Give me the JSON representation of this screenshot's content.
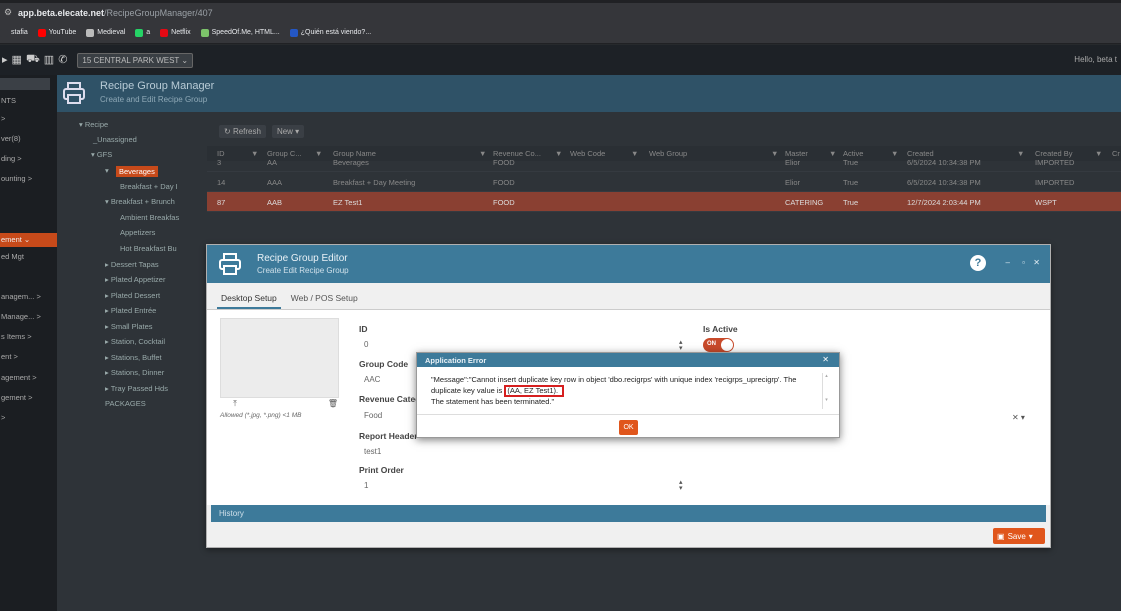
{
  "browser": {
    "url_host": "app.beta.elecate.net",
    "url_path": "/RecipeGroupManager/407",
    "bookmarks": [
      {
        "label": "stafia",
        "icon": "folder-icon",
        "color": "#35363a"
      },
      {
        "label": "YouTube",
        "icon": "youtube-icon",
        "color": "#ff0000"
      },
      {
        "label": "Medieval",
        "icon": "folder-icon",
        "color": "#bbbbbb"
      },
      {
        "label": "a",
        "icon": "whatsapp-icon",
        "color": "#25d366"
      },
      {
        "label": "Netflix",
        "icon": "netflix-icon",
        "color": "#e50914"
      },
      {
        "label": "SpeedOf.Me, HTML...",
        "icon": "speed-icon",
        "color": "#7cc36a"
      },
      {
        "label": "¿Quién está viendo?...",
        "icon": "m-icon",
        "color": "#2457c5"
      }
    ]
  },
  "app": {
    "location": "15 CENTRAL PARK WEST",
    "hello": "Hello, beta t"
  },
  "sidebar": {
    "items": [
      {
        "label": "NTS"
      },
      {
        "label": ">"
      },
      {
        "label": "ver(8)"
      },
      {
        "label": "ding  >"
      },
      {
        "label": "ounting  >"
      },
      {
        "label": "ement  ⌄"
      },
      {
        "label": "ed Mgt"
      },
      {
        "label": "anagem...  >"
      },
      {
        "label": "Manage...  >"
      },
      {
        "label": "s Items  >"
      },
      {
        "label": "ent  >"
      },
      {
        "label": "agement  >"
      },
      {
        "label": "gement  >"
      },
      {
        "label": ">"
      }
    ]
  },
  "page": {
    "title": "Recipe Group Manager",
    "subtitle": "Create and Edit Recipe Group"
  },
  "tree": {
    "nodes": [
      {
        "label": "▾  Recipe"
      },
      {
        "label": "_Unassigned"
      },
      {
        "label": "▾  GFS"
      },
      {
        "label": "▾"
      },
      {
        "label": "Beverages"
      },
      {
        "label": "Breakfast + Day I"
      },
      {
        "label": "▾  Breakfast + Brunch"
      },
      {
        "label": "Ambient Breakfas"
      },
      {
        "label": "Appetizers"
      },
      {
        "label": "Hot Breakfast Bu"
      },
      {
        "label": "▸  Dessert Tapas"
      },
      {
        "label": "▸  Plated Appetizer"
      },
      {
        "label": "▸  Plated Dessert"
      },
      {
        "label": "▸  Plated Entrée"
      },
      {
        "label": "▸  Small Plates"
      },
      {
        "label": "▸  Station, Cocktail"
      },
      {
        "label": "▸  Stations, Buffet"
      },
      {
        "label": "▸  Stations, Dinner"
      },
      {
        "label": "▸  Tray Passed Hds"
      },
      {
        "label": "PACKAGES"
      }
    ]
  },
  "grid": {
    "refresh_label": "Refresh",
    "new_label": "New  ▾",
    "columns": [
      "ID",
      "Group C...",
      "Group Name",
      "Revenue Co...",
      "Web Code",
      "Web Group",
      "Master",
      "Active",
      "Created",
      "Created By",
      "Cr"
    ],
    "rows": [
      {
        "id": "3",
        "code": "AA",
        "name": "Beverages",
        "revenue": "FOOD",
        "master": "Elior",
        "active": "True",
        "created": "6/5/2024 10:34:38 PM",
        "created_by": "IMPORTED"
      },
      {
        "id": "14",
        "code": "AAA",
        "name": "Breakfast + Day Meeting",
        "revenue": "FOOD",
        "master": "Elior",
        "active": "True",
        "created": "6/5/2024 10:34:38 PM",
        "created_by": "IMPORTED"
      },
      {
        "id": "87",
        "code": "AAB",
        "name": "EZ Test1",
        "revenue": "FOOD",
        "master": "CATERING",
        "active": "True",
        "created": "12/7/2024 2:03:44 PM",
        "created_by": "WSPT"
      }
    ]
  },
  "editor": {
    "title": "Recipe Group Editor",
    "subtitle": "Create Edit Recipe Group",
    "tabs": [
      "Desktop Setup",
      "Web / POS Setup"
    ],
    "allowed": "Allowed (*.jpg, *.png) <1 MB",
    "fields": {
      "id_label": "ID",
      "id_value": "0",
      "group_code_label": "Group Code",
      "group_code_value": "AAC",
      "revenue_label": "Revenue Categ",
      "revenue_value": "Food",
      "report_header_label": "Report Header",
      "report_header_value": "test1",
      "print_order_label": "Print Order",
      "print_order_value": "1",
      "is_active_label": "Is Active",
      "toggle_on": "ON"
    },
    "history_label": "History",
    "save_label": "Save"
  },
  "error": {
    "title": "Application Error",
    "message_line1": "\"Message\":\"Cannot insert duplicate key row in object 'dbo.recigrps' with unique index 'recigrps_uprecigrp'. The",
    "message_line2_prefix": "duplicate key value is ",
    "message_key": "(AA, EZ Test1).",
    "message_line3": "The statement has been terminated.\"",
    "ok_label": "OK"
  }
}
